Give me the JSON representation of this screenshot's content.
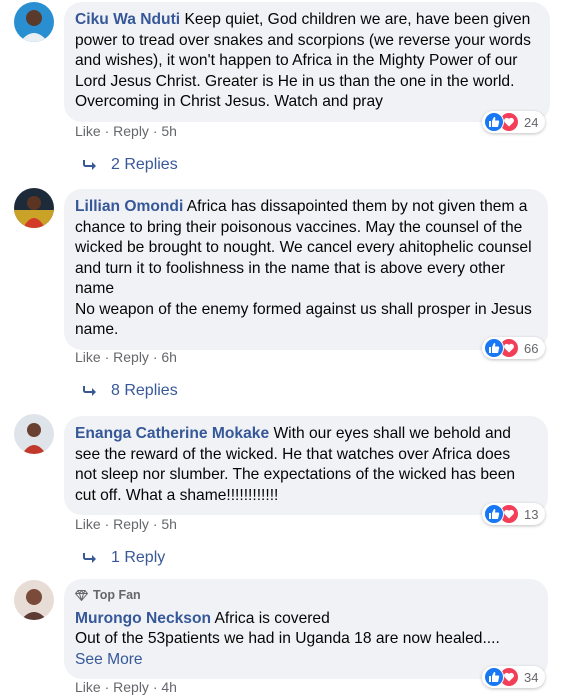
{
  "comments": [
    {
      "author": "Ciku Wa Nduti",
      "text": "Keep quiet, God children we are, have been given power to tread over snakes and scorpions (we reverse your words and wishes), it won't happen to Africa in the Mighty Power of our Lord Jesus Christ. Greater is He in us than the one in the world. Overcoming in Christ Jesus. Watch and pray",
      "like": "Like",
      "reply": "Reply",
      "time": "5h",
      "reactions": "24",
      "replies": "2 Replies"
    },
    {
      "author": "Lillian Omondi",
      "text": "Africa has dissapointed them by not given them a chance to bring their poisonous vaccines. May the counsel of the wicked be brought to nought. We cancel every ahitophelic counsel and turn it to foolishness in the name that is above every other name",
      "text2": "No weapon of the enemy formed against us shall prosper in Jesus name.",
      "like": "Like",
      "reply": "Reply",
      "time": "6h",
      "reactions": "66",
      "replies": "8 Replies"
    },
    {
      "author": "Enanga Catherine Mokake",
      "text": "With our eyes shall we behold and see the reward of the wicked. He that watches over Africa does not sleep nor slumber. The expectations of the wicked has been cut off. What a shame!!!!!!!!!!!!",
      "like": "Like",
      "reply": "Reply",
      "time": "5h",
      "reactions": "13",
      "replies": "1 Reply"
    },
    {
      "badge": "Top Fan",
      "author": "Murongo Neckson",
      "text": "Africa is covered",
      "text2": "Out of the 53patients we had in Uganda 18 are now healed....",
      "see_more": "See More",
      "like": "Like",
      "reply": "Reply",
      "time": "4h",
      "reactions": "34"
    }
  ],
  "separator": " · ",
  "colors": {
    "link": "#365899",
    "bubble": "#f0f2f5",
    "like": "#1877f2",
    "love": "#f33e58"
  }
}
